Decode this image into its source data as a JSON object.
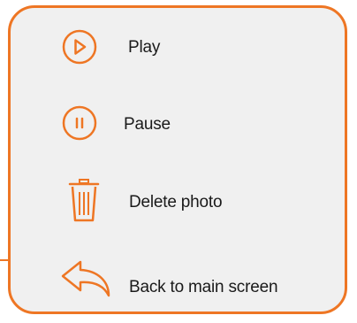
{
  "accent_color": "#ee7624",
  "panel_background": "#f0f0f0",
  "menu": {
    "items": [
      {
        "id": "play",
        "label": "Play",
        "icon": "play-circle-icon"
      },
      {
        "id": "pause",
        "label": "Pause",
        "icon": "pause-circle-icon"
      },
      {
        "id": "delete",
        "label": "Delete photo",
        "icon": "trash-icon"
      },
      {
        "id": "back",
        "label": "Back to main screen",
        "icon": "back-arrow-icon"
      }
    ]
  }
}
